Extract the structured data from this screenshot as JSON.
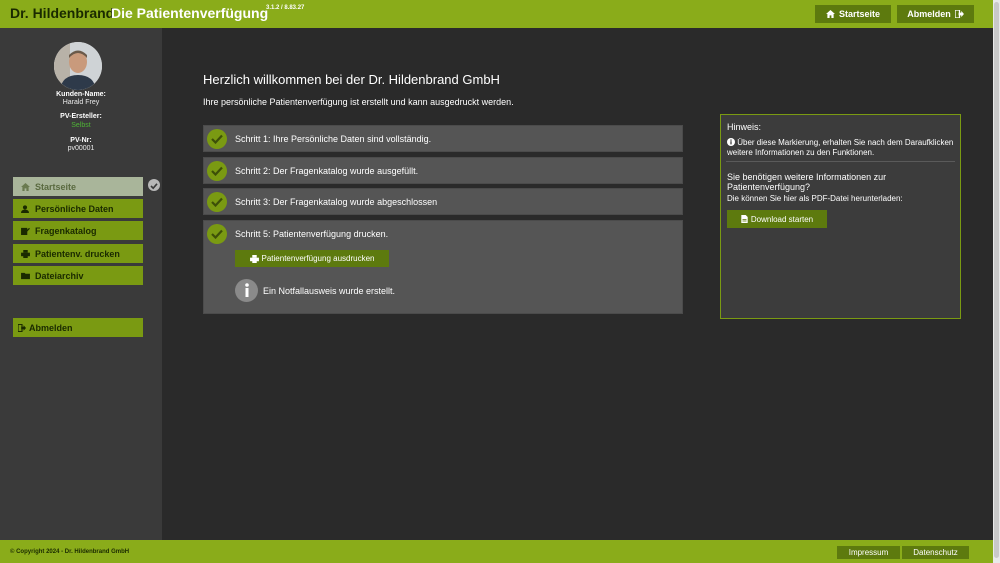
{
  "header": {
    "brand": "Dr. Hildenbrand",
    "title": "Die Patientenverfügung",
    "version": "3.1.2 / 8.83.27",
    "home_label": "Startseite",
    "logout_label": "Abmelden"
  },
  "sidebar": {
    "customer_label": "Kunden-Name:",
    "customer_value": "Harald Frey",
    "creator_label": "PV-Ersteller:",
    "creator_value": "Selbst",
    "pvnr_label": "PV-Nr:",
    "pvnr_value": "pv00001",
    "items": [
      {
        "label": "Startseite",
        "icon": "home-icon"
      },
      {
        "label": "Persönliche Daten",
        "icon": "user-icon"
      },
      {
        "label": "Fragenkatalog",
        "icon": "edit-icon"
      },
      {
        "label": "Patientenv. drucken",
        "icon": "print-icon"
      },
      {
        "label": "Dateiarchiv",
        "icon": "folder-icon"
      }
    ],
    "logout_label": "Abmelden"
  },
  "main": {
    "welcome": "Herzlich willkommen bei der Dr. Hildenbrand GmbH",
    "subtitle": "Ihre persönliche Patientenverfügung ist erstellt und kann ausgedruckt werden.",
    "steps": [
      "Schritt 1: Ihre Persönliche Daten sind vollständig.",
      "Schritt 2: Der Fragenkatalog wurde ausgefüllt.",
      "Schritt 3: Der Fragenkatalog wurde abgeschlossen",
      "Schritt 5: Patientenverfügung drucken."
    ],
    "print_label": "Patientenverfügung ausdrucken",
    "notfall_text": "Ein Notfallausweis wurde erstellt."
  },
  "hint": {
    "heading": "Hinweis:",
    "note": "Über diese Markierung, erhalten Sie nach dem Daraufklicken weitere Informationen zu den Funktionen.",
    "more_info": "Sie benötigen weitere Informationen zur Patientenverfügung?",
    "pdf_note": "Die können Sie hier als PDF-Datei herunterladen:",
    "download_label": "Download starten"
  },
  "footer": {
    "copyright": "© Copyright 2024 - Dr. Hildenbrand GmbH",
    "impressum": "Impressum",
    "datenschutz": "Datenschutz"
  },
  "colors": {
    "brand_green": "#8aac1a",
    "button_green": "#5d7a0e",
    "nav_green": "#7a9a12",
    "background": "#2a2a2a"
  }
}
